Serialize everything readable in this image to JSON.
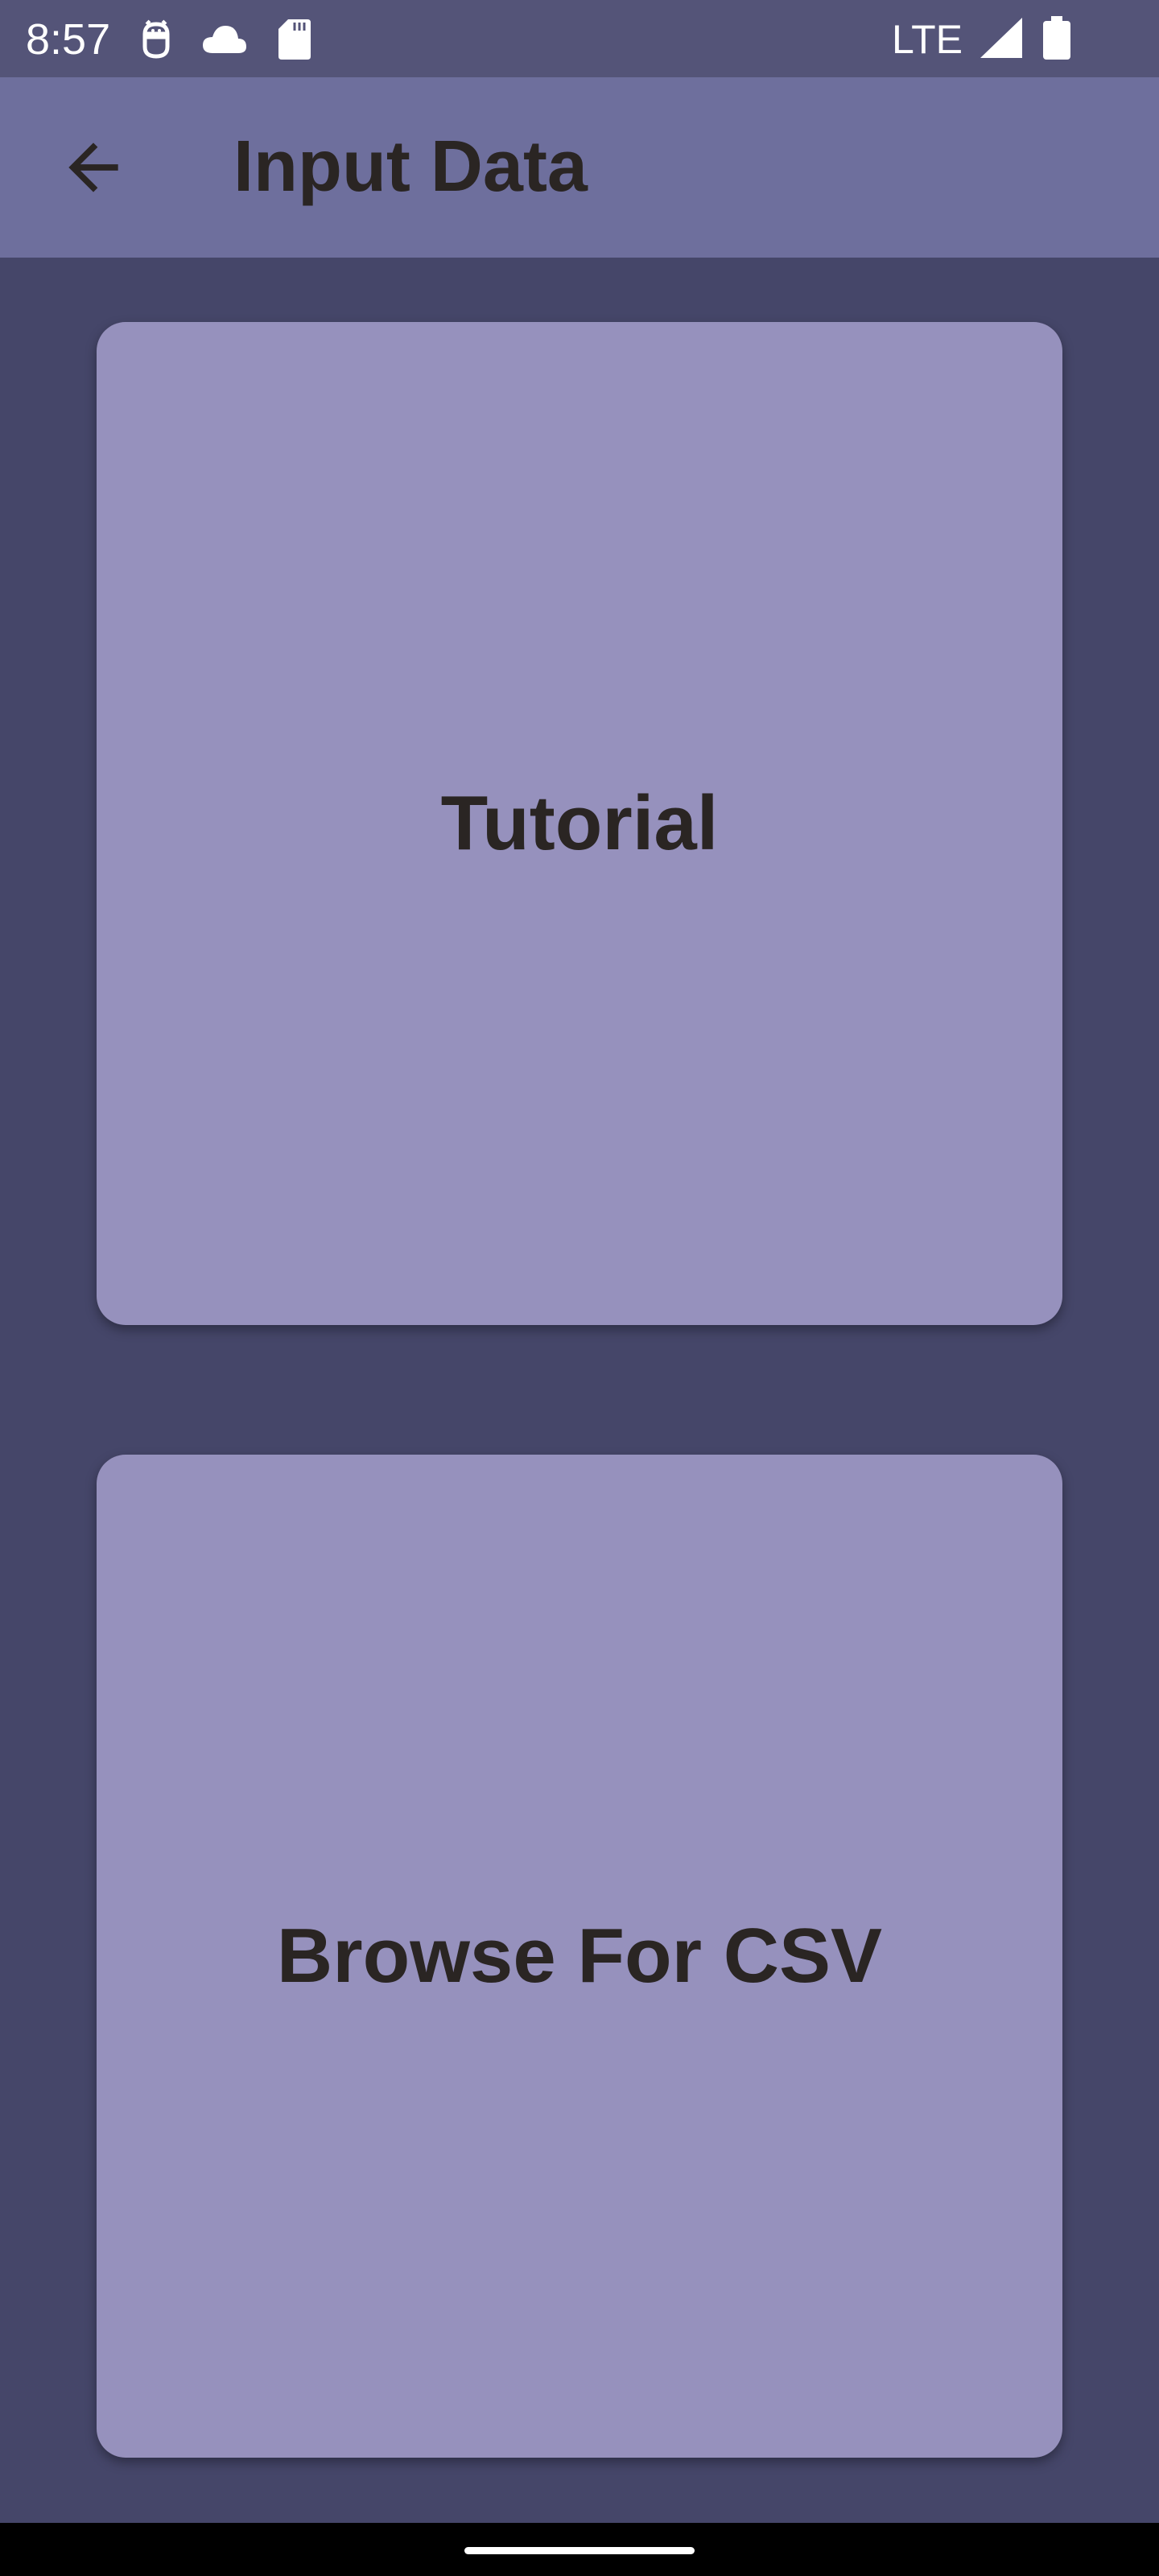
{
  "status_bar": {
    "time": "8:57",
    "network": "LTE",
    "icons": [
      "android-debug-icon",
      "cloud-icon",
      "sd-card-icon",
      "signal-icon",
      "battery-icon"
    ]
  },
  "app_bar": {
    "title": "Input Data",
    "back_icon": "arrow-left-icon"
  },
  "cards": [
    {
      "label": "Tutorial"
    },
    {
      "label": "Browse For CSV"
    }
  ],
  "colors": {
    "status_bar": "#545478",
    "app_bar": "#6e6f9d",
    "background": "#454669",
    "card": "#9691bd",
    "text": "#2a2523"
  }
}
